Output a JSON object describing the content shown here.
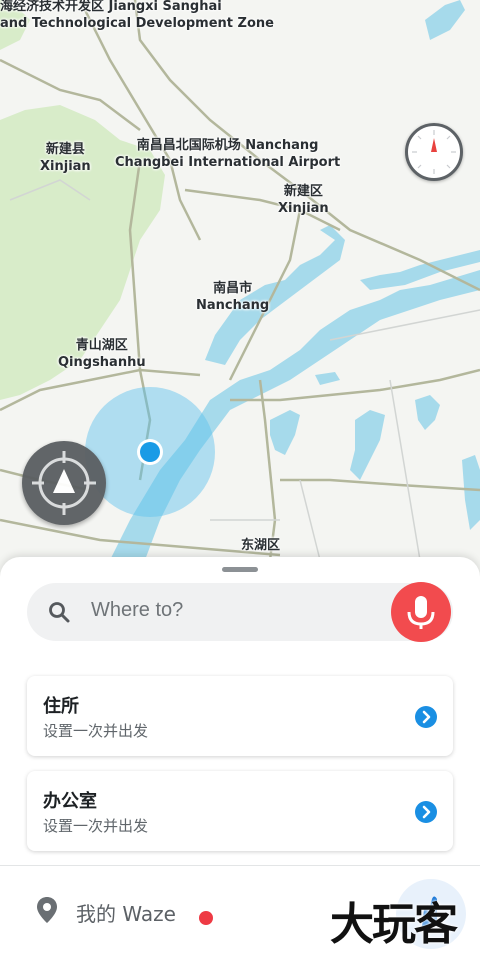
{
  "map": {
    "labels": {
      "zone_cn": "海经济技术开发区 Jiangxi Sanghai",
      "zone_en": "and Technological Development Zone",
      "xinjian_county_cn": "新建县",
      "xinjian_county_en": "Xinjian",
      "airport_cn": "南昌昌北国际机场 Nanchang",
      "airport_en": "Changbei International Airport",
      "xinjian_district_cn": "新建区",
      "xinjian_district_en": "Xinjian",
      "nanchang_cn": "南昌市",
      "nanchang_en": "Nanchang",
      "qingshanhu_cn": "青山湖区",
      "qingshanhu_en": "Qingshanhu",
      "donghu_cn": "东湖区"
    },
    "colors": {
      "water": "#a6daeb",
      "park": "#d6ebc6",
      "road": "#b9bda0",
      "location_blue": "#1a9be6"
    }
  },
  "search": {
    "placeholder": "Where to?",
    "icon": "search-icon",
    "mic_icon": "microphone-icon"
  },
  "favorites": [
    {
      "title": "住所",
      "subtitle": "设置一次并出发",
      "icon": "chevron-right-icon"
    },
    {
      "title": "办公室",
      "subtitle": "设置一次并出发",
      "icon": "chevron-right-icon"
    }
  ],
  "bottom": {
    "my_waze": "我的 Waze",
    "pin_icon": "location-pin-icon",
    "status_color": "#ee3a44"
  },
  "watermark": "大玩客"
}
